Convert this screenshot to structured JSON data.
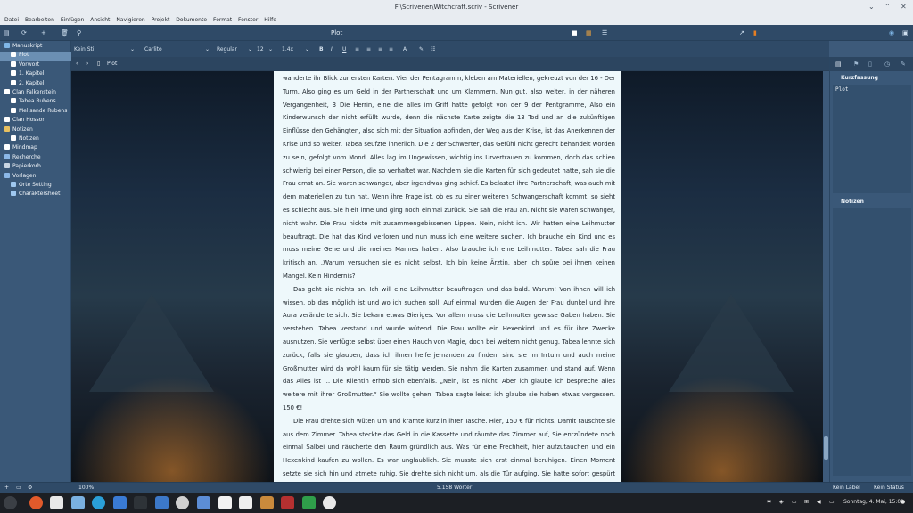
{
  "window": {
    "title": "F:\\Scrivener\\Witchcraft.scriv - Scrivener"
  },
  "menu": [
    "Datei",
    "Bearbeiten",
    "Einfügen",
    "Ansicht",
    "Navigieren",
    "Projekt",
    "Dokumente",
    "Format",
    "Fenster",
    "Hilfe"
  ],
  "toolbar": {
    "document_title": "Plot"
  },
  "format": {
    "style": "Kein Stil",
    "font": "Carlito",
    "weight": "Regular",
    "size": "12",
    "spacing": "1.4x"
  },
  "binder": [
    {
      "label": "Manuskript",
      "icon": "manuscript-icon",
      "indent": 0
    },
    {
      "label": "Plot",
      "icon": "document-icon",
      "indent": 1,
      "selected": true
    },
    {
      "label": "Vorwort",
      "icon": "document-icon",
      "indent": 1
    },
    {
      "label": "1. Kapitel",
      "icon": "document-icon",
      "indent": 1
    },
    {
      "label": "2. Kapitel",
      "icon": "document-icon",
      "indent": 1
    },
    {
      "label": "Clan Falkenstein",
      "icon": "document-icon",
      "indent": 0
    },
    {
      "label": "Tabea Rubens",
      "icon": "document-icon",
      "indent": 1
    },
    {
      "label": "Melisande Rubens",
      "icon": "document-icon",
      "indent": 1
    },
    {
      "label": "Clan Hosson",
      "icon": "document-icon",
      "indent": 0
    },
    {
      "label": "Notizen",
      "icon": "pencil-icon",
      "indent": 0
    },
    {
      "label": "Notizen",
      "icon": "document-icon",
      "indent": 1
    },
    {
      "label": "Mindmap",
      "icon": "cloud-icon",
      "indent": 0
    },
    {
      "label": "Recherche",
      "icon": "folder-icon",
      "indent": 0
    },
    {
      "label": "Papierkorb",
      "icon": "trash-icon",
      "indent": 0
    },
    {
      "label": "Vorlagen",
      "icon": "folder-icon",
      "indent": 0
    },
    {
      "label": "Orte Setting",
      "icon": "template-icon",
      "indent": 1
    },
    {
      "label": "Charaktersheet",
      "icon": "template-icon",
      "indent": 1
    }
  ],
  "path": {
    "doc": "Plot"
  },
  "editor": {
    "paragraphs": [
      "wanderte ihr Blick zur ersten Karten. Vier der Pentagramm, kleben am Materiellen, gekreuzt von der 16 - Der Turm. Also ging es um Geld in der Partnerschaft und um Klammern. Nun gut, also weiter, in der näheren Vergangenheit, 3 Die Herrin, eine die alles im Griff hatte gefolgt von der 9 der Pentgramme, Also ein Kinderwunsch der nicht erfüllt wurde, denn die nächste Karte zeigte die 13 Tod und an die zukünftigen Einflüsse den Gehängten, also sich mit der Situation abfinden, der Weg aus der Krise, ist das Anerkennen der Krise und so weiter. Tabea seufzte innerlich. Die 2 der Schwerter, das Gefühl nicht gerecht behandelt worden zu sein, gefolgt vom Mond. Alles lag im Ungewissen, wichtig ins Urvertrauen zu kommen, doch das schien schwierig bei einer Person, die so verhaftet war. Nachdem sie die Karten für sich gedeutet hatte, sah sie die Frau ernst an. Sie waren schwanger, aber irgendwas ging schief. Es belastet ihre Partnerschaft, was auch mit dem materiellen zu tun hat. Wenn ihre Frage ist, ob es zu einer weiteren Schwangerschaft kommt, so sieht es schlecht aus. Sie hielt inne und ging noch einmal zurück. Sie sah die Frau an. Nicht sie waren schwanger, nicht wahr. Die Frau nickte mit zusammengebissenen Lippen. Nein, nicht ich. Wir hatten eine Leihmutter beauftragt. Die hat das Kind verloren und nun muss ich eine weitere suchen. Ich brauche ein Kind und es muss meine Gene und die meines Mannes haben. Also brauche ich eine Leihmutter. Tabea sah die Frau kritisch an. „Warum versuchen sie es nicht selbst. Ich bin keine Ärztin, aber ich spüre bei ihnen keinen Mangel. Kein Hindernis?",
      "Das geht sie nichts an. Ich will eine Leihmutter beauftragen und das bald. Warum! Von ihnen will ich wissen, ob das möglich ist und wo ich suchen soll. Auf einmal wurden die Augen der Frau dunkel und ihre Aura veränderte sich. Sie bekam etwas Gieriges. Vor allem muss die Leihmutter gewisse Gaben haben. Sie verstehen. Tabea verstand und wurde wütend. Die Frau wollte ein Hexenkind und es für ihre Zwecke ausnutzen. Sie verfügte selbst über einen Hauch von Magie, doch bei weitem nicht genug. Tabea lehnte sich zurück, falls sie glauben, dass ich ihnen helfe jemanden zu finden, sind sie im Irrtum und auch meine Großmutter wird da wohl kaum für sie tätig werden. Sie nahm die Karten zusammen und stand auf. Wenn das Alles ist … Die Klientin erhob sich ebenfalls. „Nein, ist es nicht. Aber ich glaube ich bespreche alles weitere mit ihrer Großmutter.“ Sie wollte gehen. Tabea sagte leise: ich glaube sie haben etwas vergessen. 150 €!",
      "Die Frau drehte sich wüten um und kramte kurz in ihrer Tasche. Hier, 150 € für nichts. Damit rauschte sie aus dem Zimmer. Tabea steckte das Geld in die Kassette und räumte das Zimmer auf, Sie entzündete noch einmal Salbei und  räucherte den Raum gründlich aus. Was für eine Frechheit, hier aufzutauchen und ein Hexenkind kaufen zu wollen. Es war unglaublich. Sie musste sich erst einmal beruhigen. Einen Moment setzte sie sich hin und atmete ruhig. Sie drehte sich nicht um, als die Tür aufging. Sie hatte sofort gespürt wer es war. „Hej Mel, sagte sie und wandte sich um. Melisande setzte sich"
    ]
  },
  "inspector": {
    "synopsis_header": "Kurzfassung",
    "synopsis_text": "Plot",
    "notes_header": "Notizen"
  },
  "footer": {
    "zoom": "100%",
    "word_count": "5.158 Wörter",
    "label": "Kein Label",
    "status": "Kein Status"
  },
  "taskbar": {
    "datetime": "Sonntag, 4. Mai, 15:01"
  },
  "colors": {
    "accent": "#2f4a67",
    "binder_bg": "#3a5878",
    "selected": "#6b8fb3",
    "paper": "#eef8fb"
  }
}
